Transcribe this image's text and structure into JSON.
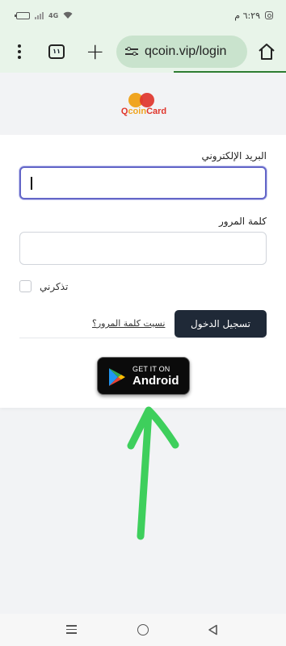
{
  "status_bar": {
    "time": "٦:٢٩ م",
    "battery": "▭",
    "network": "4G"
  },
  "browser": {
    "url": "qcoin.vip/login",
    "tab_count": "١١"
  },
  "brand": {
    "logo_q": "Q",
    "logo_coin": "coin",
    "logo_card": "Card"
  },
  "form": {
    "email_label": "البريد الإلكتروني",
    "email_value": "",
    "password_label": "كلمة المرور",
    "password_value": "",
    "remember_label": "تذكرني",
    "forgot_link": "نسيت كلمة المرور؟",
    "login_button": "تسجيل الدخول"
  },
  "store_badge": {
    "small_text": "GET IT ON",
    "big_text": "Android"
  },
  "colors": {
    "browser_bar": "#e8f4e9",
    "url_pill": "#c9e3cd",
    "primary_button": "#1f2937",
    "focus_border": "#6366c8",
    "arrow": "#3ecf5c"
  }
}
